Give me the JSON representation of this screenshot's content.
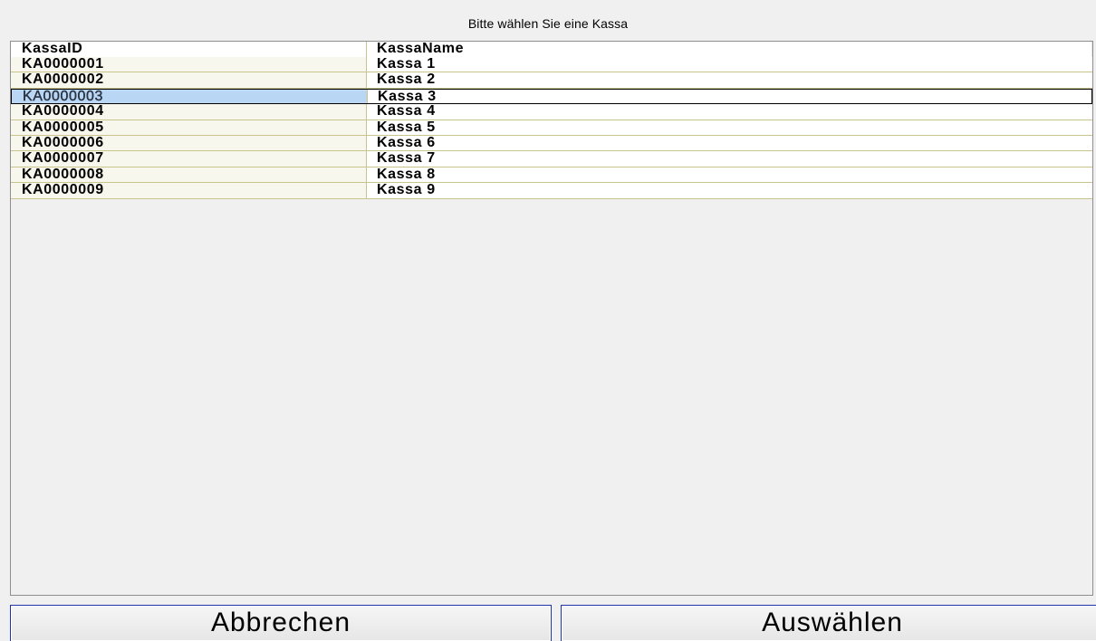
{
  "dialog": {
    "title": "Bitte wählen Sie eine Kassa"
  },
  "grid": {
    "columns": [
      "KassaID",
      "KassaName"
    ],
    "rows": [
      {
        "id": "KA0000001",
        "name": "Kassa 1",
        "selected": false
      },
      {
        "id": "KA0000002",
        "name": "Kassa 2",
        "selected": false
      },
      {
        "id": "KA0000003",
        "name": "Kassa 3",
        "selected": true
      },
      {
        "id": "KA0000004",
        "name": "Kassa 4",
        "selected": false
      },
      {
        "id": "KA0000005",
        "name": "Kassa 5",
        "selected": false
      },
      {
        "id": "KA0000006",
        "name": "Kassa 6",
        "selected": false
      },
      {
        "id": "KA0000007",
        "name": "Kassa 7",
        "selected": false
      },
      {
        "id": "KA0000008",
        "name": "Kassa 8",
        "selected": false
      },
      {
        "id": "KA0000009",
        "name": "Kassa 9",
        "selected": false
      }
    ]
  },
  "buttons": {
    "cancel_label": "Abbrechen",
    "select_label": "Auswählen"
  },
  "colors": {
    "selection_highlight": "#b9d6f5",
    "button_border": "#2233aa",
    "row_separator": "#c9c38c"
  }
}
